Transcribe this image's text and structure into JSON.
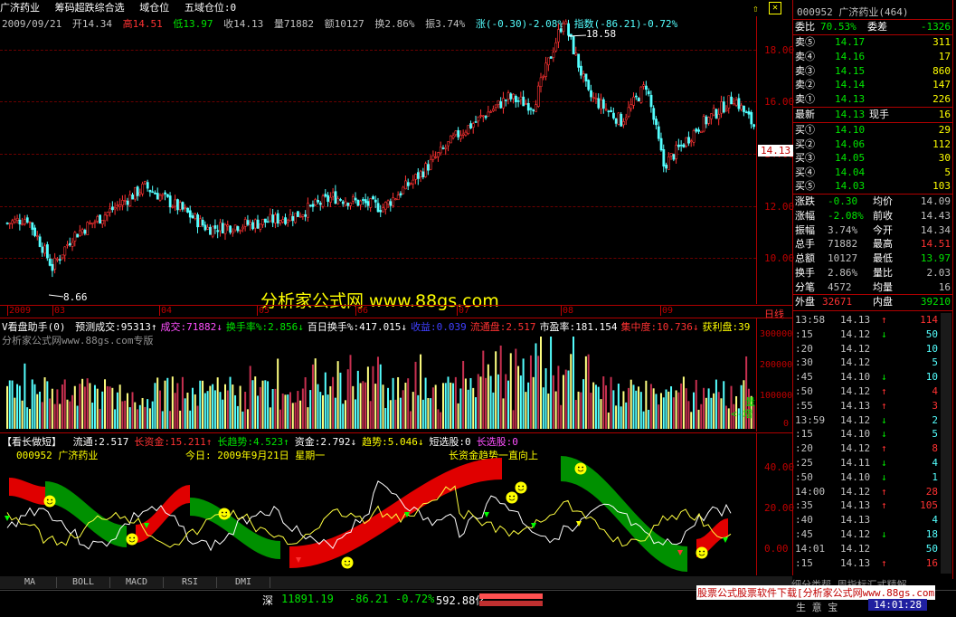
{
  "header": {
    "stock_name": "广济药业",
    "items": [
      "筹码超跌综合选",
      "域仓位",
      "五域仓位:0"
    ]
  },
  "kline_info": {
    "date": "2009/09/21",
    "open": "开14.34",
    "high": "高14.51",
    "low": "低13.97",
    "close": "收14.13",
    "volume": "量71882",
    "amount": "额10127",
    "turnover": "换2.86%",
    "amplitude": "振3.74%",
    "change": "涨(-0.30)-2.08%",
    "index": "指数(-86.21)-0.72%"
  },
  "price_axis": [
    "18.00",
    "16.00",
    "14.00",
    "12.00",
    "10.00"
  ],
  "price_marker": "14.13",
  "annotations": {
    "high": "18.58",
    "low": "8.66"
  },
  "period_label": "日线",
  "month_labels": [
    "2009",
    "03",
    "04",
    "05",
    "06",
    "07",
    "08",
    "09"
  ],
  "watermark": "分析家公式网 www.88gs.com",
  "volume_pane": {
    "title": "V看盘助手(0)",
    "items": [
      {
        "text": "预测成交:95313↑",
        "color": "#ffffff"
      },
      {
        "text": "成交:71882↓",
        "color": "#ff50ff"
      },
      {
        "text": "换手率%:2.856↓",
        "color": "#00e600"
      },
      {
        "text": "百日换手%:417.015↓",
        "color": "#ffffff"
      },
      {
        "text": "收益:0.039",
        "color": "#4040ff"
      },
      {
        "text": "流通盘:2.517",
        "color": "#ff3232"
      },
      {
        "text": "市盈率:181.154",
        "color": "#ffffff"
      },
      {
        "text": "集中度:10.736↓",
        "color": "#ff3232"
      },
      {
        "text": "获利盘:39",
        "color": "#ffff00"
      }
    ],
    "subtitle": "分析家公式网www.88gs.com专版",
    "axis": [
      "300000",
      "200000",
      "100000",
      "0"
    ],
    "legend_up": "量",
    "legend_down": "<-增"
  },
  "indicator_pane": {
    "title": "【看长做短】",
    "items": [
      {
        "text": "流通:2.517",
        "color": "#ffffff"
      },
      {
        "text": "长资金:15.211↑",
        "color": "#ff3232"
      },
      {
        "text": "长趋势:4.523↑",
        "color": "#00e600"
      },
      {
        "text": "资金:2.792↓",
        "color": "#ffffff"
      },
      {
        "text": "趋势:5.046↓",
        "color": "#ffff00"
      },
      {
        "text": "短选股:0",
        "color": "#ffffff"
      },
      {
        "text": "长选股:0",
        "color": "#ff50ff"
      }
    ],
    "line2_code": "000952  广济药业",
    "line2_date": "今日: 2009年9月21日 星期一",
    "line2_note": "长资金趋势一直向上",
    "axis": [
      "40.00",
      "20.00",
      "0.00"
    ]
  },
  "tabs": [
    "MA",
    "BOLL",
    "MACD",
    "RSI",
    "DMI"
  ],
  "quote_panel": {
    "title": "000952  广济药业(464)",
    "weibi": "70.53%",
    "weicha": "-1326",
    "asks": [
      {
        "label": "卖⑤",
        "price": "14.17",
        "vol": "311"
      },
      {
        "label": "卖④",
        "price": "14.16",
        "vol": "17"
      },
      {
        "label": "卖③",
        "price": "14.15",
        "vol": "860"
      },
      {
        "label": "卖②",
        "price": "14.14",
        "vol": "147"
      },
      {
        "label": "卖①",
        "price": "14.13",
        "vol": "226"
      }
    ],
    "last": {
      "label": "最新",
      "price": "14.13",
      "label2": "现手",
      "vol": "16"
    },
    "bids": [
      {
        "label": "买①",
        "price": "14.10",
        "vol": "29"
      },
      {
        "label": "买②",
        "price": "14.06",
        "vol": "112"
      },
      {
        "label": "买③",
        "price": "14.05",
        "vol": "30"
      },
      {
        "label": "买④",
        "price": "14.04",
        "vol": "5"
      },
      {
        "label": "买⑤",
        "price": "14.03",
        "vol": "103"
      }
    ],
    "stats": [
      {
        "l1": "涨跌",
        "v1": "-0.30",
        "l2": "均价",
        "v2": "14.09",
        "c1": "#00e600",
        "c2": "#c0c0c0"
      },
      {
        "l1": "涨幅",
        "v1": "-2.08%",
        "l2": "前收",
        "v2": "14.43",
        "c1": "#00e600",
        "c2": "#c0c0c0"
      },
      {
        "l1": "振幅",
        "v1": "3.74%",
        "l2": "今开",
        "v2": "14.34",
        "c1": "#c0c0c0",
        "c2": "#c0c0c0"
      },
      {
        "l1": "总手",
        "v1": "71882",
        "l2": "最高",
        "v2": "14.51",
        "c1": "#c0c0c0",
        "c2": "#ff3232"
      },
      {
        "l1": "总额",
        "v1": "10127",
        "l2": "最低",
        "v2": "13.97",
        "c1": "#c0c0c0",
        "c2": "#00e600"
      },
      {
        "l1": "换手",
        "v1": "2.86%",
        "l2": "量比",
        "v2": "2.03",
        "c1": "#c0c0c0",
        "c2": "#c0c0c0"
      },
      {
        "l1": "分笔",
        "v1": "4572",
        "l2": "均量",
        "v2": "16",
        "c1": "#c0c0c0",
        "c2": "#c0c0c0"
      }
    ],
    "outer": {
      "l1": "外盘",
      "v1": "32671",
      "l2": "内盘",
      "v2": "39210"
    }
  },
  "ticks": [
    {
      "time": "13:58",
      "price": "14.13",
      "arrow": "↑",
      "vol": "114"
    },
    {
      "time": ":15",
      "price": "14.12",
      "arrow": "↓",
      "vol": "50"
    },
    {
      "time": ":20",
      "price": "14.12",
      "arrow": "",
      "vol": "10"
    },
    {
      "time": ":30",
      "price": "14.12",
      "arrow": "",
      "vol": "5"
    },
    {
      "time": ":45",
      "price": "14.10",
      "arrow": "↓",
      "vol": "10"
    },
    {
      "time": ":50",
      "price": "14.12",
      "arrow": "↑",
      "vol": "4"
    },
    {
      "time": ":55",
      "price": "14.13",
      "arrow": "↑",
      "vol": "3"
    },
    {
      "time": "13:59",
      "price": "14.12",
      "arrow": "↓",
      "vol": "2"
    },
    {
      "time": ":15",
      "price": "14.10",
      "arrow": "↓",
      "vol": "5"
    },
    {
      "time": ":20",
      "price": "14.12",
      "arrow": "↑",
      "vol": "8"
    },
    {
      "time": ":25",
      "price": "14.11",
      "arrow": "↓",
      "vol": "4"
    },
    {
      "time": ":50",
      "price": "14.10",
      "arrow": "↓",
      "vol": "1"
    },
    {
      "time": "14:00",
      "price": "14.12",
      "arrow": "↑",
      "vol": "28"
    },
    {
      "time": ":35",
      "price": "14.13",
      "arrow": "↑",
      "vol": "105"
    },
    {
      "time": ":40",
      "price": "14.13",
      "arrow": "",
      "vol": "4"
    },
    {
      "time": ":45",
      "price": "14.12",
      "arrow": "↓",
      "vol": "18"
    },
    {
      "time": "14:01",
      "price": "14.12",
      "arrow": "",
      "vol": "50"
    },
    {
      "time": ":15",
      "price": "14.13",
      "arrow": "↑",
      "vol": "16"
    }
  ],
  "status": {
    "index_name": "深",
    "index_value": "11891.19",
    "index_change": "-86.21",
    "index_pct": "-0.72%",
    "index_amount": "592.88亿",
    "ticker_text": "股票公式股票软件下载[分析家公式网www.88gs.com",
    "ticker_text2": "细分类帮 周指标汇式精解",
    "time": "14:01:28",
    "tray": "生 意 宝"
  }
}
